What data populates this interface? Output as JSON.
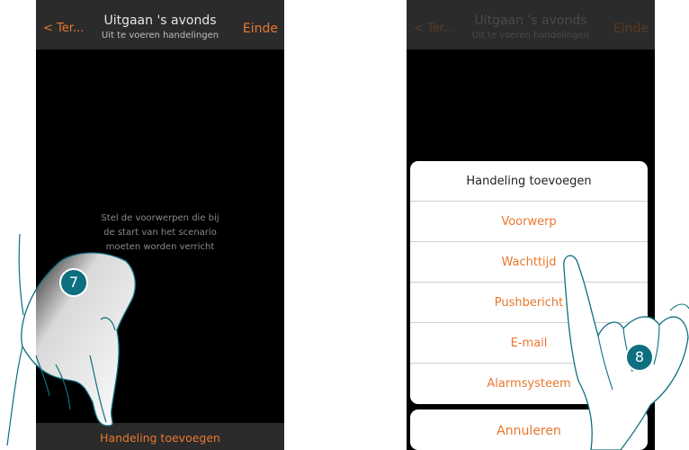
{
  "left_screen": {
    "header": {
      "back_label": "Ter...",
      "title": "Uitgaan 's avonds",
      "subtitle": "Uit te voeren handelingen",
      "done_label": "Einde"
    },
    "hint_lines": [
      "Stel de voorwerpen die bij",
      "de start van het scenario",
      "moeten worden verricht"
    ],
    "bottom_button": "Handeling toevoegen",
    "step_badge": "7"
  },
  "right_screen": {
    "header": {
      "back_label": "Ter...",
      "title": "Uitgaan 's avonds",
      "subtitle": "Uit te voeren handelingen",
      "done_label": "Einde"
    },
    "sheet": {
      "title": "Handeling toevoegen",
      "items": [
        "Voorwerp",
        "Wachttijd",
        "Pushbericht",
        "E-mail",
        "Alarmsysteem"
      ]
    },
    "cancel_label": "Annuleren",
    "step_badge": "8"
  },
  "colors": {
    "accent": "#e8772e",
    "badge": "#0e6f80",
    "header": "#2b2b2b",
    "screen": "#000000"
  },
  "icons": [
    "chevron-left-icon",
    "pointing-hand-icon"
  ]
}
